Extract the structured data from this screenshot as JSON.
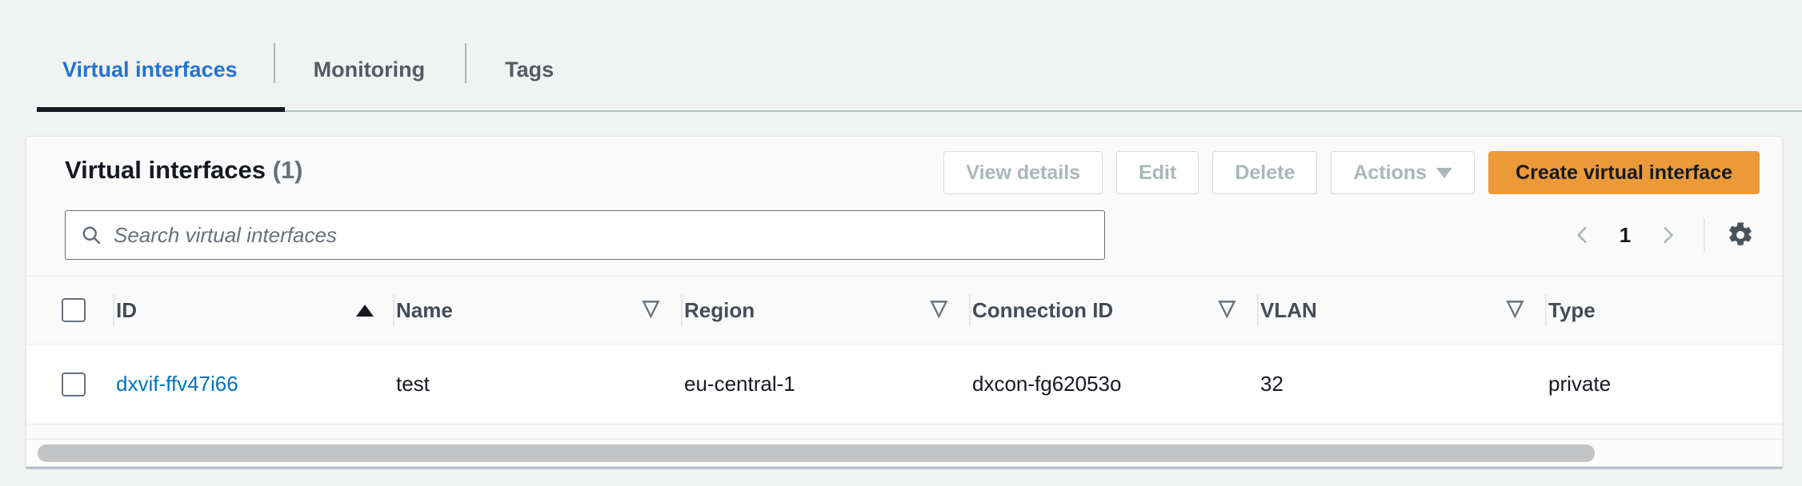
{
  "colors": {
    "page_bg": "#f1f3f3",
    "card_bg": "#fafafa",
    "accent_orange": "#ec9a39",
    "link_blue": "#0073bb",
    "tab_active_blue": "#2074d5",
    "text_dark": "#16191f",
    "text_muted": "#687078",
    "disabled_text": "#aab7b8"
  },
  "tabs": [
    {
      "label": "Virtual interfaces",
      "active": true
    },
    {
      "label": "Monitoring",
      "active": false
    },
    {
      "label": "Tags",
      "active": false
    }
  ],
  "panel": {
    "title": "Virtual interfaces",
    "count": "(1)",
    "buttons": {
      "view_details": "View details",
      "edit": "Edit",
      "delete": "Delete",
      "actions": "Actions",
      "create": "Create virtual interface"
    }
  },
  "search": {
    "placeholder": "Search virtual interfaces",
    "value": "",
    "icon": "search-icon"
  },
  "pagination": {
    "prev_icon": "chevron-left-icon",
    "page": "1",
    "next_icon": "chevron-right-icon",
    "settings_icon": "gear-icon"
  },
  "table": {
    "columns": [
      {
        "label": "ID",
        "sort": "asc"
      },
      {
        "label": "Name",
        "sort": "none"
      },
      {
        "label": "Region",
        "sort": "none"
      },
      {
        "label": "Connection ID",
        "sort": "none"
      },
      {
        "label": "VLAN",
        "sort": "none"
      },
      {
        "label": "Type",
        "sort": ""
      }
    ],
    "rows": [
      {
        "id": "dxvif-ffv47i66",
        "name": "test",
        "region": "eu-central-1",
        "connection_id": "dxcon-fg62053o",
        "vlan": "32",
        "type": "private"
      }
    ]
  }
}
